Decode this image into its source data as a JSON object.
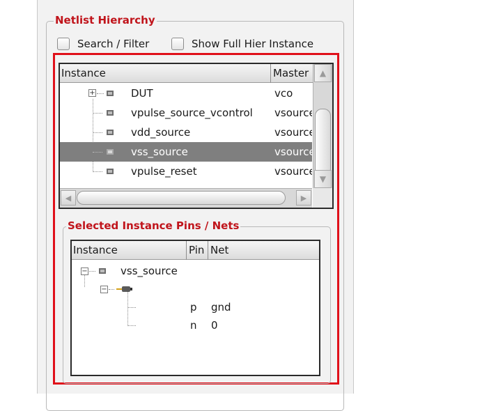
{
  "netlist_group": {
    "title": "Netlist Hierarchy"
  },
  "checkboxes": [
    {
      "label": "Search / Filter",
      "checked": false
    },
    {
      "label": "Show Full Hier Instance",
      "checked": false
    }
  ],
  "instance_tree": {
    "columns": [
      "Instance",
      "Master"
    ],
    "rows": [
      {
        "name": "DUT",
        "master": "vco",
        "expandable": true
      },
      {
        "name": "vpulse_source_vcontrol",
        "master": "vsource"
      },
      {
        "name": "vdd_source",
        "master": "vsource"
      },
      {
        "name": "vss_source",
        "master": "vsource",
        "selected": true
      },
      {
        "name": "vpulse_reset",
        "master": "vsource"
      }
    ]
  },
  "pins_group": {
    "title": "Selected Instance Pins / Nets"
  },
  "pins_tree": {
    "columns": [
      "Instance",
      "Pin",
      "Net"
    ],
    "instance": "vss_source",
    "pins": [
      {
        "pin": "p",
        "net": "gnd"
      },
      {
        "pin": "n",
        "net": "0"
      }
    ]
  },
  "colors": {
    "title_red": "#c0141b",
    "highlight_frame": "#e0101a",
    "selected_row": "#7f7f7f"
  }
}
